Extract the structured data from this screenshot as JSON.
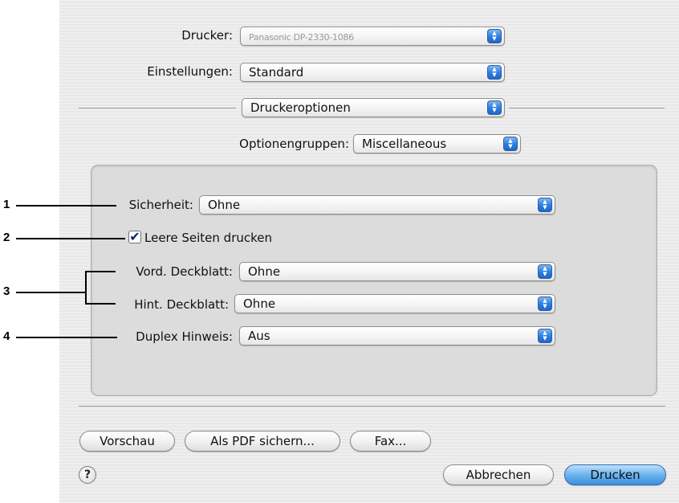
{
  "printer": {
    "label": "Drucker:",
    "value": "Panasonic DP-2330-1086"
  },
  "settings": {
    "label": "Einstellungen:",
    "value": "Standard"
  },
  "panel_select": {
    "value": "Druckeroptionen"
  },
  "option_groups": {
    "label": "Optionengruppen:",
    "value": "Miscellaneous"
  },
  "options": {
    "security": {
      "label": "Sicherheit:",
      "value": "Ohne"
    },
    "blank_pages": {
      "label": "Leere Seiten drucken",
      "checked": true,
      "check_glyph": "✔"
    },
    "front_cover": {
      "label": "Vord. Deckblatt:",
      "value": "Ohne"
    },
    "back_cover": {
      "label": "Hint. Deckblatt:",
      "value": "Ohne"
    },
    "duplex_notice": {
      "label": "Duplex Hinweis:",
      "value": "Aus"
    }
  },
  "buttons": {
    "preview": "Vorschau",
    "save_pdf": "Als PDF sichern...",
    "fax": "Fax...",
    "cancel": "Abbrechen",
    "print": "Drucken",
    "help": "?"
  },
  "popup_arrows": {
    "up": "▲",
    "down": "▼"
  },
  "callouts": [
    "1",
    "2",
    "3",
    "4"
  ]
}
